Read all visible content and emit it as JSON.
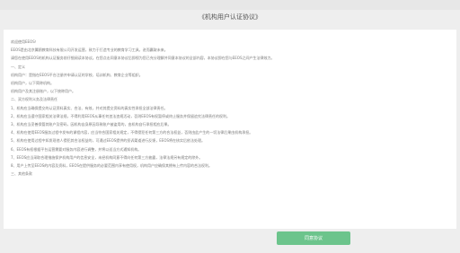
{
  "page": {
    "title": "《机构用户认证协议》"
  },
  "agreement": {
    "lines": [
      "欢迎使用EEOS！",
      "EEOS是由北京翼鸥教育科技有限公司开发运营，致力于打造专业的教育学习工具，进而赢取未来。",
      "请您在使用EEOS的机构认证服务前仔细阅读本协议。在您点击同意本协议后即视为您已充分理解并同意本协议的全部内容，本协议即在您与EEOS之间产生法律效力。",
      "一、定义",
      "机构用户：是指在EEOS平台注册并申请认证的学校、培训机构、教育企业等组织。",
      "机构用户，以下简称机构。",
      "机构用户及其注册账户，以下统称用户。",
      "二、双方权利义务及法律责任",
      "1、机构应当确保提交的认证资料真实、合法、有效，并对其提交资料的真实性承担全部法律责任。",
      "2、机构应当遵守国家相关法律法规，不得利用EEOS从事任何违法违规活动，否则EEOS有权暂停或终止服务并保留追究法律责任的权利。",
      "3、机构应当妥善保管其账户及密码，因机构自身原因导致账户被盗用的，由机构自行承担相应后果。",
      "4、机构在使用EEOS服务过程中发布的课程内容，应当符合国家相关规定，不得侵犯任何第三方的合法权益，否则由此产生的一切法律后果由机构承担。",
      "5、机构在使用过程中如发现他人侵犯其合法权益的，可通过EEOS提供的投诉渠道进行反馈，EEOS将在核实后依法处理。",
      "6、EEOS有权根据平台运营需要对服务内容进行调整，并将以适当方式通知机构。",
      "7、EEOS应当采取合理措施保护机构用户的信息安全，未经机构同意不得向任何第三方披露，法律法规另有规定的除外。",
      "8、用户上传至EEOS的内容及资料，EEOS在提供服务的必要范围内享有使用权，机构用户应确保其拥有上传内容的合法权利。",
      "三、其他条款"
    ]
  },
  "buttons": {
    "agree_label": "同意协议"
  }
}
